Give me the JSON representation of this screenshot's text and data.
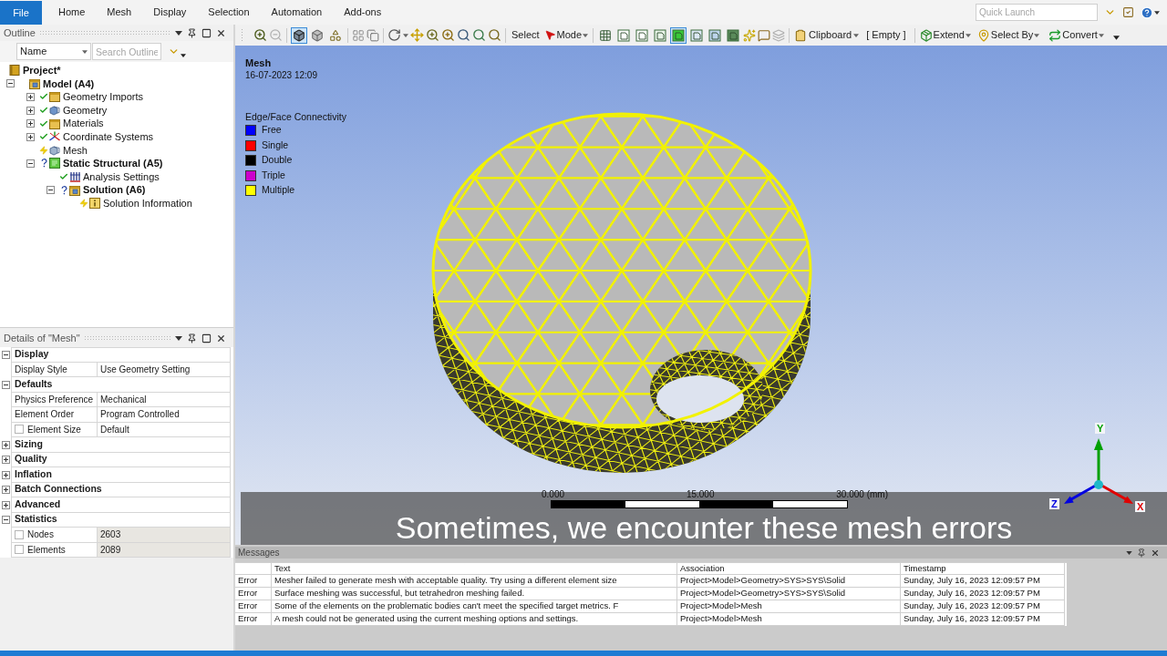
{
  "ribbon": {
    "file": "File",
    "tabs": [
      "Home",
      "Mesh",
      "Display",
      "Selection",
      "Automation",
      "Add-ons"
    ],
    "quick_launch": {
      "placeholder": "Quick Launch"
    }
  },
  "toolbar": {
    "display_modes": [
      {
        "selected": true
      },
      {
        "selected": false
      },
      {
        "selected": false
      }
    ],
    "select": "Select",
    "mode": "Mode",
    "select_filters": [
      {
        "selected": false
      },
      {
        "selected": false
      },
      {
        "selected": false
      },
      {
        "selected": false
      },
      {
        "selected": true
      },
      {
        "selected": false
      },
      {
        "selected": false
      },
      {
        "selected": false
      }
    ],
    "clipboard": "Clipboard",
    "clipboard_content": "[ Empty ]",
    "extend": "Extend",
    "select_by": "Select By",
    "convert": "Convert"
  },
  "outline": {
    "title": "Outline",
    "filter": "Name",
    "search": {
      "placeholder": "Search Outline"
    },
    "tree": [
      {
        "label": "Project*",
        "kind": "project",
        "bold": true,
        "expandable": false,
        "children": [
          {
            "label": "Model (A4)",
            "kind": "model",
            "bold": true,
            "expandable": true,
            "expanded": true,
            "children": [
              {
                "label": "Geometry Imports",
                "kind": "imports",
                "defined": true,
                "up_to_date": true,
                "bold": false,
                "expandable": true,
                "expanded": false
              },
              {
                "label": "Geometry",
                "kind": "geometry",
                "defined": true,
                "up_to_date": true,
                "bold": false,
                "expandable": true,
                "expanded": false
              },
              {
                "label": "Materials",
                "kind": "materials",
                "defined": true,
                "up_to_date": true,
                "bold": false,
                "expandable": true,
                "expanded": false
              },
              {
                "label": "Coordinate Systems",
                "kind": "coordinates",
                "defined": true,
                "up_to_date": true,
                "bold": false,
                "expandable": true,
                "expanded": false
              },
              {
                "label": "Mesh",
                "kind": "mesh",
                "defined": true,
                "up_to_date": false,
                "bold": false,
                "expandable": false
              },
              {
                "label": "Static Structural (A5)",
                "kind": "analysis",
                "defined": false,
                "bold": true,
                "expandable": true,
                "expanded": true,
                "children": [
                  {
                    "label": "Analysis Settings",
                    "kind": "settings",
                    "defined": true,
                    "up_to_date": true,
                    "bold": false,
                    "expandable": false
                  },
                  {
                    "label": "Solution (A6)",
                    "kind": "solution",
                    "defined": false,
                    "bold": true,
                    "expandable": true,
                    "expanded": true,
                    "children": [
                      {
                        "label": "Solution Information",
                        "kind": "information",
                        "defined": true,
                        "up_to_date": false,
                        "bold": false,
                        "expandable": false
                      }
                    ]
                  }
                ]
              }
            ]
          }
        ]
      }
    ]
  },
  "details": {
    "title": "Details of \"Mesh\"",
    "groups": [
      {
        "label": "Display",
        "expanded": true,
        "rows": [
          {
            "kind": "plain",
            "name": "Display Style",
            "value": "Use Geometry Setting",
            "readonly": false
          }
        ]
      },
      {
        "label": "Defaults",
        "expanded": true,
        "rows": [
          {
            "kind": "plain",
            "name": "Physics Preference",
            "value": "Mechanical",
            "readonly": false
          },
          {
            "kind": "plain",
            "name": "Element Order",
            "value": "Program Controlled",
            "readonly": false
          },
          {
            "kind": "parameter",
            "name": "Element Size",
            "value": "Default",
            "checked": false,
            "readonly": false
          }
        ]
      },
      {
        "label": "Sizing",
        "expanded": false
      },
      {
        "label": "Quality",
        "expanded": false
      },
      {
        "label": "Inflation",
        "expanded": false
      },
      {
        "label": "Batch Connections",
        "expanded": false
      },
      {
        "label": "Advanced",
        "expanded": false
      },
      {
        "label": "Statistics",
        "expanded": true,
        "rows": [
          {
            "kind": "parameter",
            "name": "Nodes",
            "value": "2603",
            "checked": false,
            "readonly": true
          },
          {
            "kind": "parameter",
            "name": "Elements",
            "value": "2089",
            "checked": false,
            "readonly": true
          }
        ]
      }
    ]
  },
  "viewport": {
    "title": "Mesh",
    "date": "16-07-2023 12:09",
    "legend": {
      "title": "Edge/Face Connectivity",
      "items": [
        {
          "label": "Free",
          "color": "#0000ff"
        },
        {
          "label": "Single",
          "color": "#ff0000"
        },
        {
          "label": "Double",
          "color": "#000000"
        },
        {
          "label": "Triple",
          "color": "#cc00cc"
        },
        {
          "label": "Multiple",
          "color": "#ffff00"
        }
      ]
    },
    "scale": [
      "0.000",
      "15.000",
      "30.000 (mm)"
    ],
    "triad": [
      {
        "label": "Y",
        "color": "#00a000"
      },
      {
        "label": "X",
        "color": "#e00000"
      },
      {
        "label": "Z",
        "color": "#0000e0"
      }
    ]
  },
  "caption": "Sometimes, we encounter these mesh errors",
  "messages": {
    "title": "Messages",
    "columns": [
      "Text",
      "Association",
      "Timestamp"
    ],
    "rows": [
      {
        "type": "Error",
        "text": "Mesher failed to generate mesh with acceptable quality. Try using a different element size",
        "association": "Project>Model>Geometry>SYS>SYS\\Solid",
        "timestamp": "Sunday, July 16, 2023 12:09:57 PM"
      },
      {
        "type": "Error",
        "text": "Surface meshing was successful, but tetrahedron meshing failed.",
        "association": "Project>Model>Geometry>SYS>SYS\\Solid",
        "timestamp": "Sunday, July 16, 2023 12:09:57 PM"
      },
      {
        "type": "Error",
        "text": "Some of the elements on the problematic bodies can't meet the specified target metrics. F",
        "association": "Project>Model>Mesh",
        "timestamp": "Sunday, July 16, 2023 12:09:57 PM"
      },
      {
        "type": "Error",
        "text": "A mesh could not be generated using the current meshing options and settings.",
        "association": "Project>Model>Mesh",
        "timestamp": "Sunday, July 16, 2023 12:09:57 PM"
      }
    ]
  }
}
